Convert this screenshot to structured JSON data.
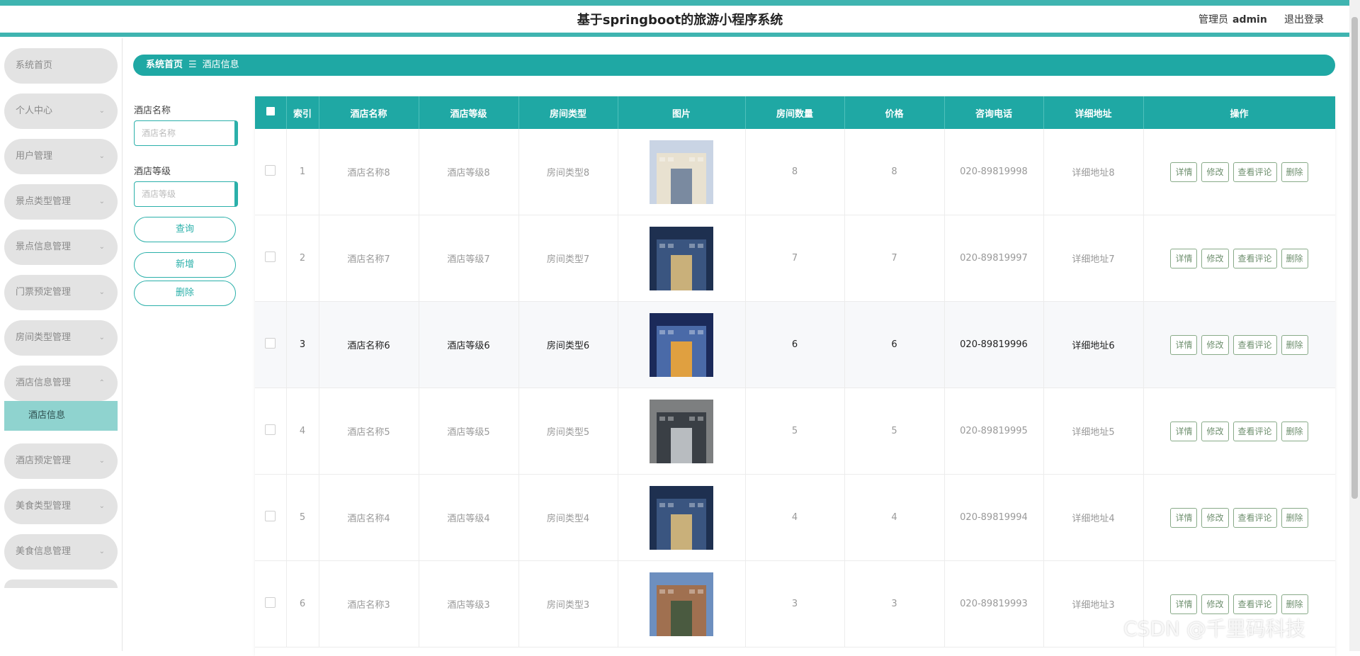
{
  "header": {
    "title": "基于springboot的旅游小程序系统",
    "admin_label": "管理员",
    "admin_name": "admin",
    "logout": "退出登录"
  },
  "sidebar": {
    "items": [
      {
        "label": "系统首页",
        "chevron": ""
      },
      {
        "label": "个人中心",
        "chevron": "⌄"
      },
      {
        "label": "用户管理",
        "chevron": "⌄"
      },
      {
        "label": "景点类型管理",
        "chevron": "⌄"
      },
      {
        "label": "景点信息管理",
        "chevron": "⌄"
      },
      {
        "label": "门票预定管理",
        "chevron": "⌄"
      },
      {
        "label": "房间类型管理",
        "chevron": "⌄"
      },
      {
        "label": "酒店信息管理",
        "chevron": "⌃"
      },
      {
        "label": "酒店预定管理",
        "chevron": "⌄"
      },
      {
        "label": "美食类型管理",
        "chevron": "⌄"
      },
      {
        "label": "美食信息管理",
        "chevron": "⌄"
      }
    ],
    "submenu": {
      "label": "酒店信息"
    }
  },
  "breadcrumb": {
    "home": "系统首页",
    "separator": "☰",
    "current": "酒店信息"
  },
  "search": {
    "name_label": "酒店名称",
    "name_placeholder": "酒店名称",
    "level_label": "酒店等级",
    "level_placeholder": "酒店等级",
    "query_button": "查询",
    "add_button": "新增",
    "delete_button": "删除"
  },
  "table": {
    "headers": [
      "索引",
      "酒店名称",
      "酒店等级",
      "房间类型",
      "图片",
      "房间数量",
      "价格",
      "咨询电话",
      "详细地址",
      "操作"
    ],
    "actions": {
      "detail": "详情",
      "edit": "修改",
      "comments": "查看评论",
      "delete": "删除"
    },
    "rows": [
      {
        "index": "1",
        "name": "酒店名称8",
        "level": "酒店等级8",
        "room_type": "房间类型8",
        "rooms": "8",
        "price": "8",
        "phone": "020-89819998",
        "address": "详细地址8"
      },
      {
        "index": "2",
        "name": "酒店名称7",
        "level": "酒店等级7",
        "room_type": "房间类型7",
        "rooms": "7",
        "price": "7",
        "phone": "020-89819997",
        "address": "详细地址7"
      },
      {
        "index": "3",
        "name": "酒店名称6",
        "level": "酒店等级6",
        "room_type": "房间类型6",
        "rooms": "6",
        "price": "6",
        "phone": "020-89819996",
        "address": "详细地址6"
      },
      {
        "index": "4",
        "name": "酒店名称5",
        "level": "酒店等级5",
        "room_type": "房间类型5",
        "rooms": "5",
        "price": "5",
        "phone": "020-89819995",
        "address": "详细地址5"
      },
      {
        "index": "5",
        "name": "酒店名称4",
        "level": "酒店等级4",
        "room_type": "房间类型4",
        "rooms": "4",
        "price": "4",
        "phone": "020-89819994",
        "address": "详细地址4"
      },
      {
        "index": "6",
        "name": "酒店名称3",
        "level": "酒店等级3",
        "room_type": "房间类型3",
        "rooms": "3",
        "price": "3",
        "phone": "020-89819993",
        "address": "详细地址3"
      }
    ]
  },
  "watermark": "CSDN @千里码科技",
  "colors": {
    "accent": "#1fa8a4",
    "stripe": "#3fb4b0",
    "submenu_bg": "#8fd3cf",
    "sidebar_item_bg": "#e3e3e3"
  }
}
